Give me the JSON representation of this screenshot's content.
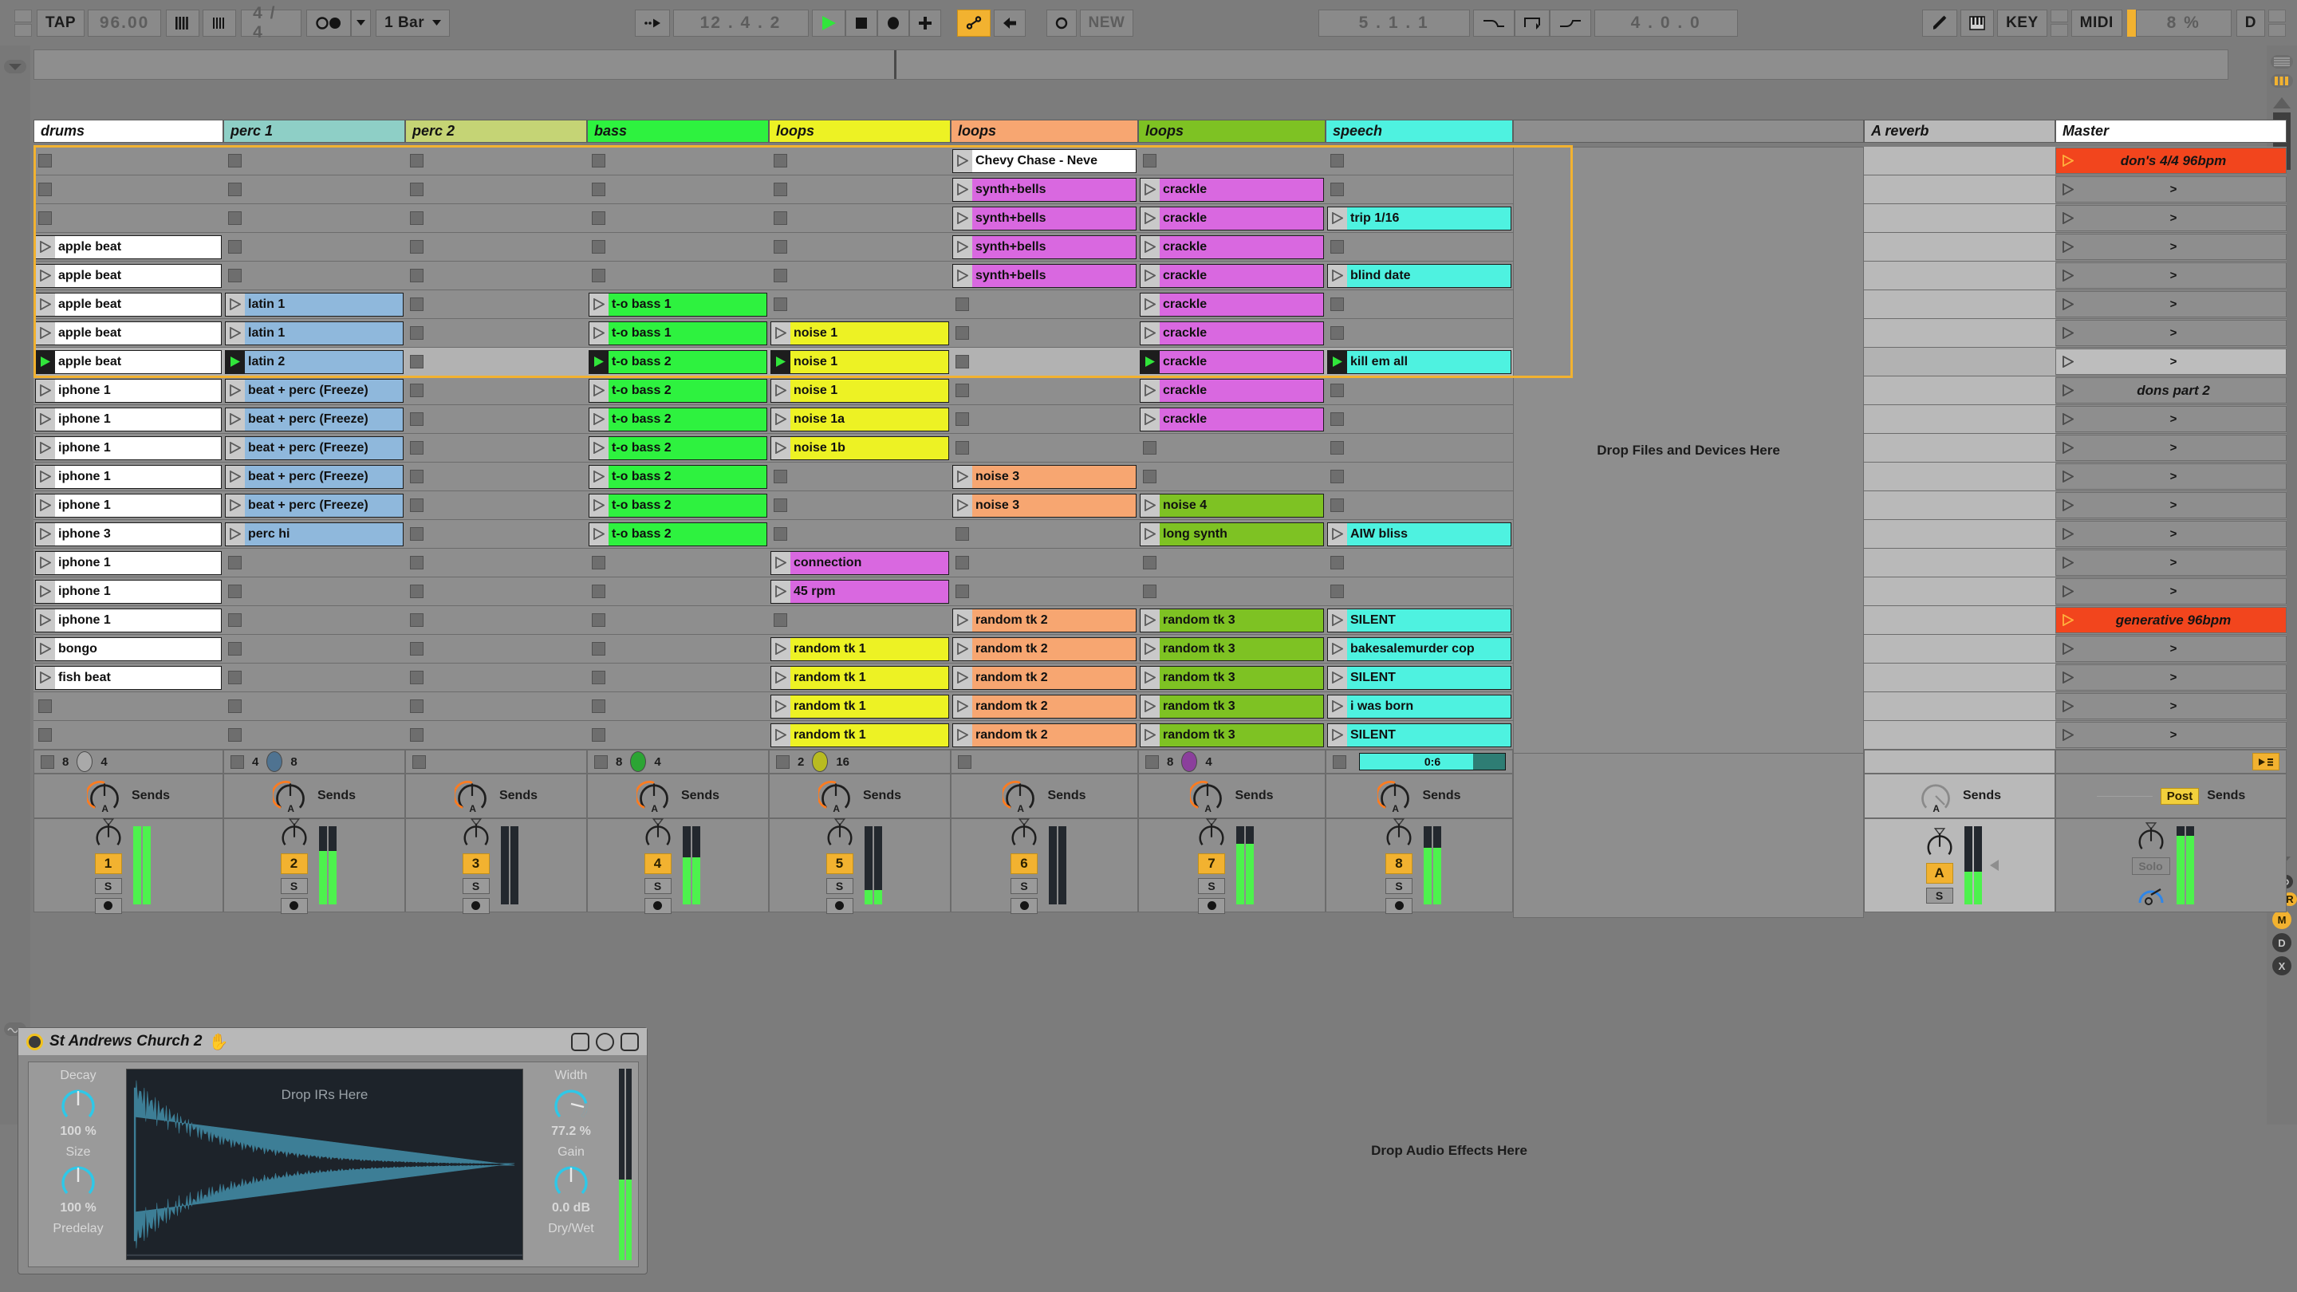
{
  "control_bar": {
    "tap_label": "TAP",
    "tempo": "96.00",
    "metronome_icon": "metronome-icon",
    "nudge_icon": "nudge-icon",
    "time_signature": "4 / 4",
    "follow_icon": "follow-icon",
    "quantization": "1 Bar",
    "arrangement_position": "12 . 4 . 2",
    "play_label": "play",
    "stop_label": "stop",
    "record_label": "record",
    "capture_label": "capture",
    "link_label": "link",
    "back_to_arrangement": "back-to-arrangement",
    "midi_arm": "midi-arm",
    "new_label": "NEW",
    "loop_position": "5 . 1 . 1",
    "punch_in_icon": "punch-in-icon",
    "loop_icon": "loop-icon",
    "punch_out_icon": "punch-out-icon",
    "loop_length": "4 . 0 . 0",
    "draw_mode_icon": "pencil-icon",
    "computer_midi_keyboard_icon": "piano-icon",
    "key_label": "KEY",
    "midi_label": "MIDI",
    "cpu_load": "8 %",
    "disk_overload": "D"
  },
  "tracks": [
    {
      "name": "drums",
      "color": "#ffffff",
      "clip_color": "#ffffff",
      "number": "1",
      "stop_row": {
        "left": "8",
        "right": "4",
        "oval_color": "#a9a9a9"
      },
      "has_send_a": true,
      "meter": 100,
      "meter_clip": "#ff7b1f"
    },
    {
      "name": "perc 1",
      "color": "#8ecfc6",
      "clip_color": "#8fb8dc",
      "number": "2",
      "stop_row": {
        "left": "4",
        "right": "8",
        "oval_color": "#4f7391"
      },
      "has_send_a": true,
      "meter": 68
    },
    {
      "name": "perc 2",
      "color": "#c5d475",
      "clip_color": "#c5d475",
      "number": "3",
      "stop_row": {
        "left": "",
        "right": "",
        "oval_color": ""
      },
      "has_send_a": true,
      "meter": 0
    },
    {
      "name": "bass",
      "color": "#2ef23f",
      "clip_color": "#2ef23f",
      "number": "4",
      "stop_row": {
        "left": "8",
        "right": "4",
        "oval_color": "#2ca534"
      },
      "has_send_a": true,
      "meter": 60
    },
    {
      "name": "loops",
      "color": "#edf224",
      "clip_color": "#edf224",
      "number": "5",
      "stop_row": {
        "left": "2",
        "right": "16",
        "oval_color": "#b8bb20"
      },
      "has_send_a": true,
      "meter": 18
    },
    {
      "name": "loops",
      "color": "#f7a671",
      "clip_color": "#f7a671",
      "number": "6",
      "stop_row": {
        "left": "",
        "right": "",
        "oval_color": ""
      },
      "has_send_a": true,
      "meter": 0
    },
    {
      "name": "loops",
      "color": "#7ec223",
      "clip_color": "#7ec223",
      "number": "7",
      "stop_row": {
        "left": "8",
        "right": "4",
        "oval_color": "#8b3f9c"
      },
      "has_send_a": true,
      "meter": 78
    },
    {
      "name": "speech",
      "color": "#4ef2e0",
      "clip_color": "#4ef2e0",
      "number": "8",
      "stop_row": {
        "left": "",
        "right": "",
        "oval_color": "",
        "timer": "0:6"
      },
      "has_send_a": true,
      "meter": 72
    }
  ],
  "return_track": {
    "name": "A reverb",
    "letter": "A",
    "solo_label": "S",
    "sends_label": "Sends",
    "send_a_label": "A",
    "meter": 42
  },
  "master_track": {
    "name": "Master",
    "sends_label": "Sends",
    "post_label": "Post",
    "solo_label": "Solo",
    "crossfade_icon": "crossfade-icon",
    "meter": 88
  },
  "drop_zones": {
    "files_devices": "Drop Files and Devices Here",
    "audio_effects": "Drop Audio Effects Here",
    "irs": "Drop IRs Here"
  },
  "scene_rows": [
    {
      "name": "don's 4/4 96bpm",
      "highlight": "#f2451d",
      "bold": true
    },
    {
      "name": ">"
    },
    {
      "name": ">"
    },
    {
      "name": ">"
    },
    {
      "name": ">"
    },
    {
      "name": ">"
    },
    {
      "name": ">"
    },
    {
      "name": ">",
      "selected": true
    },
    {
      "name": "dons part 2",
      "bold": true
    },
    {
      "name": ">"
    },
    {
      "name": ">"
    },
    {
      "name": ">"
    },
    {
      "name": ">"
    },
    {
      "name": ">"
    },
    {
      "name": ">"
    },
    {
      "name": ">"
    },
    {
      "name": "generative 96bpm",
      "highlight": "#f2451d",
      "bold": true
    },
    {
      "name": ">"
    },
    {
      "name": ">"
    },
    {
      "name": ">"
    },
    {
      "name": ">"
    }
  ],
  "clip_grid": [
    [
      "",
      "",
      "",
      "",
      "",
      "Chevy Chase - Neve",
      "",
      ""
    ],
    [
      "",
      "",
      "",
      "",
      "",
      "synth+bells",
      "crackle",
      ""
    ],
    [
      "",
      "",
      "",
      "",
      "",
      "synth+bells",
      "crackle",
      "trip 1/16"
    ],
    [
      "apple beat",
      "",
      "",
      "",
      "",
      "synth+bells",
      "crackle",
      ""
    ],
    [
      "apple beat",
      "",
      "",
      "",
      "",
      "synth+bells",
      "crackle",
      "blind date"
    ],
    [
      "apple beat",
      "latin 1",
      "",
      "t-o bass 1",
      "",
      "",
      "crackle",
      ""
    ],
    [
      "apple beat",
      "latin 1",
      "",
      "t-o bass 1",
      "noise 1",
      "",
      "crackle",
      ""
    ],
    [
      "apple beat",
      "latin 2",
      "",
      "t-o bass 2",
      "noise 1",
      "",
      "crackle",
      "kill em all"
    ],
    [
      "iphone 1",
      "beat + perc (Freeze)",
      "",
      "t-o bass 2",
      "noise 1",
      "",
      "crackle",
      ""
    ],
    [
      "iphone 1",
      "beat + perc (Freeze)",
      "",
      "t-o bass 2",
      "noise 1a",
      "",
      "crackle",
      ""
    ],
    [
      "iphone 1",
      "beat + perc (Freeze)",
      "",
      "t-o bass 2",
      "noise 1b",
      "",
      "",
      ""
    ],
    [
      "iphone 1",
      "beat + perc (Freeze)",
      "",
      "t-o bass 2",
      "",
      "noise 3",
      "",
      ""
    ],
    [
      "iphone 1",
      "beat + perc (Freeze)",
      "",
      "t-o bass 2",
      "",
      "noise 3",
      "noise 4",
      ""
    ],
    [
      "iphone 3",
      "perc hi",
      "",
      "t-o bass 2",
      "",
      "",
      "long synth",
      "AIW bliss"
    ],
    [
      "iphone 1",
      "",
      "",
      "",
      "connection",
      "",
      "",
      ""
    ],
    [
      "iphone 1",
      "",
      "",
      "",
      "45 rpm",
      "",
      "",
      ""
    ],
    [
      "iphone 1",
      "",
      "",
      "",
      "",
      "random tk 2",
      "random tk 3",
      "SILENT"
    ],
    [
      "bongo",
      "",
      "",
      "",
      "random tk 1",
      "random tk 2",
      "random tk 3",
      "bakesalemurder cop"
    ],
    [
      "fish beat",
      "",
      "",
      "",
      "random tk 1",
      "random tk 2",
      "random tk 3",
      "SILENT"
    ],
    [
      "",
      "",
      "",
      "",
      "random tk 1",
      "random tk 2",
      "random tk 3",
      "i was born"
    ],
    [
      "",
      "",
      "",
      "",
      "random tk 1",
      "random tk 2",
      "random tk 3",
      "SILENT"
    ]
  ],
  "clip_overrides": {
    "0_5": "#ffffff",
    "1_5": "#d968e0",
    "1_6": "#d968e0",
    "2_5": "#d968e0",
    "2_6": "#d968e0",
    "3_5": "#d968e0",
    "3_6": "#d968e0",
    "4_5": "#d968e0",
    "4_6": "#d968e0",
    "5_6": "#d968e0",
    "6_6": "#d968e0",
    "7_6": "#d968e0",
    "8_6": "#d968e0",
    "9_6": "#d968e0",
    "11_5": "#f7a671",
    "12_5": "#f7a671",
    "12_6": "#7ec223",
    "13_6": "#7ec223",
    "14_4": "#d968e0",
    "15_4": "#d968e0"
  },
  "playing_row": 7,
  "device": {
    "title": "St Andrews Church 2",
    "hand_icon": "hand-icon",
    "save_icon": "save-icon",
    "hotswap_icon": "hotswap-icon",
    "lock_icon": "lock-icon",
    "params": [
      {
        "label": "Decay",
        "value": "100 %",
        "side": "left"
      },
      {
        "label": "Size",
        "value": "100 %",
        "side": "left"
      },
      {
        "label": "Predelay",
        "value": "",
        "side": "left"
      },
      {
        "label": "Width",
        "value": "77.2 %",
        "side": "right"
      },
      {
        "label": "Gain",
        "value": "0.0 dB",
        "side": "right"
      },
      {
        "label": "Dry/Wet",
        "value": "",
        "side": "right"
      }
    ]
  },
  "rails": {
    "left_top_icon": "chevron-down-icon",
    "left_bottom_icon": "waveform-icon",
    "right_icons": [
      "list-icon",
      "levels-icon",
      "io-icon",
      "sends-icon",
      "returns-icon",
      "mixer-icon",
      "delay-icon",
      "crossfader-icon"
    ],
    "session_record_icon": "session-record-icon",
    "s_label": "S",
    "r_label": "R",
    "m_label": "M",
    "d_label": "D",
    "x_label": "X"
  }
}
